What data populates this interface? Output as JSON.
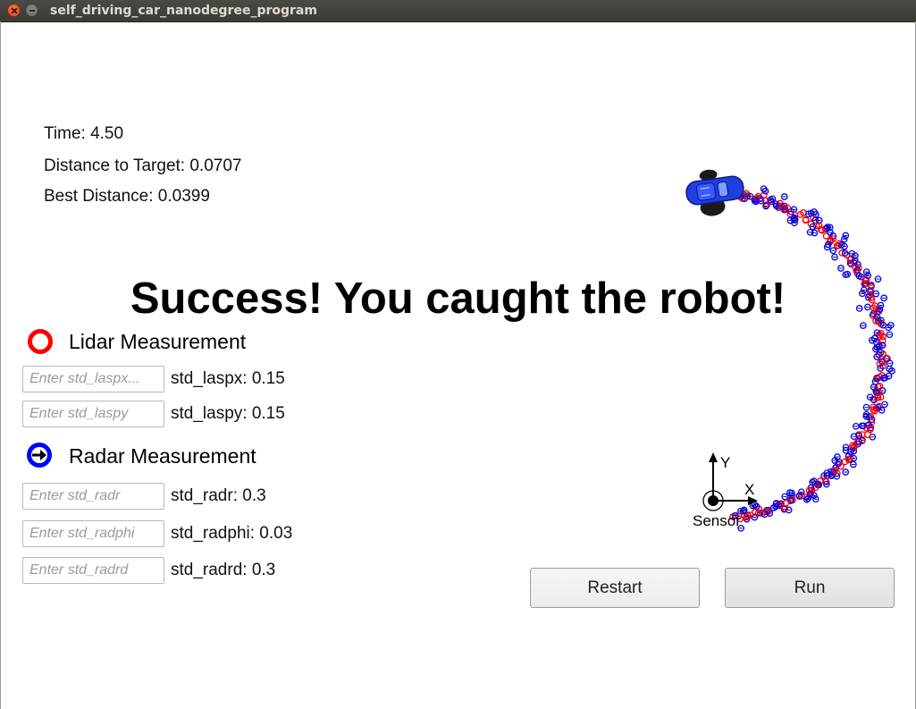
{
  "window": {
    "title": "self_driving_car_nanodegree_program"
  },
  "stats": {
    "time": "Time: 4.50",
    "distance_to_target": "Distance to Target: 0.0707",
    "best_distance": "Best Distance: 0.0399"
  },
  "banner": {
    "message": "Success! You caught the robot!"
  },
  "legend": {
    "lidar_label": "Lidar Measurement",
    "radar_label": "Radar Measurement",
    "lidar_color": "#ff0000",
    "radar_color": "#0000ff"
  },
  "params": [
    {
      "placeholder": "Enter std_laspx...",
      "value": "",
      "label": "std_laspx: 0.15"
    },
    {
      "placeholder": "Enter std_laspy",
      "value": "",
      "label": "std_laspy: 0.15"
    },
    {
      "placeholder": "Enter std_radr",
      "value": "",
      "label": "std_radr: 0.3"
    },
    {
      "placeholder": "Enter std_radphi",
      "value": "",
      "label": "std_radphi: 0.03"
    },
    {
      "placeholder": "Enter std_radrd",
      "value": "",
      "label": "std_radrd: 0.3"
    }
  ],
  "axes": {
    "y_label": "Y",
    "x_label": "X",
    "sensor_label": "Sensor"
  },
  "buttons": {
    "restart_label": "Restart",
    "run_label": "Run"
  },
  "icons": {
    "lidar": "red-ring-icon",
    "radar": "blue-ring-arrow-icon",
    "car": "blue-car-icon",
    "sensor": "sensor-target-icon"
  }
}
